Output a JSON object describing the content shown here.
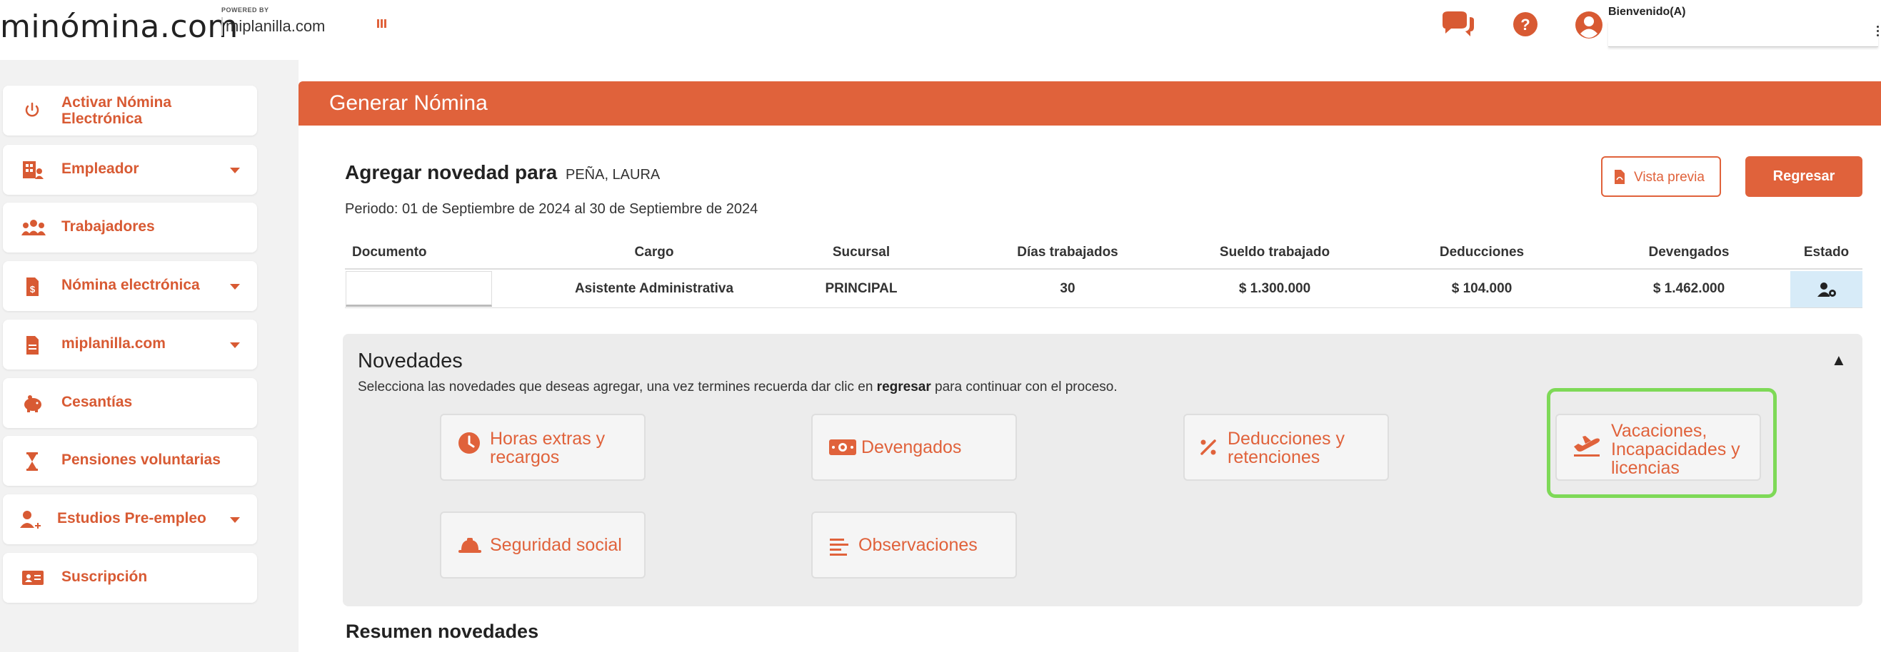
{
  "brand": {
    "logo": "minómina.com",
    "powered_by": "POWERED BY",
    "sub_brand": "miplanilla.com"
  },
  "header": {
    "welcome": "Bienvenido(A)",
    "welcome_value": ""
  },
  "sidebar": {
    "items": [
      {
        "label": "Activar Nómina\nElectrónica",
        "icon": "power-icon",
        "has_caret": false
      },
      {
        "label": "Empleador",
        "icon": "building-icon",
        "has_caret": true
      },
      {
        "label": "Trabajadores",
        "icon": "users-icon",
        "has_caret": false
      },
      {
        "label": "Nómina electrónica",
        "icon": "invoice-dollar-icon",
        "has_caret": true
      },
      {
        "label": "miplanilla.com",
        "icon": "document-icon",
        "has_caret": true
      },
      {
        "label": "Cesantías",
        "icon": "piggy-bank-icon",
        "has_caret": false
      },
      {
        "label": "Pensiones voluntarias",
        "icon": "hourglass-icon",
        "has_caret": false
      },
      {
        "label": "Estudios Pre-empleo",
        "icon": "user-plus-icon",
        "has_caret": true
      },
      {
        "label": "Suscripción",
        "icon": "id-card-icon",
        "has_caret": false
      }
    ]
  },
  "page": {
    "title": "Generar Nómina",
    "agregar_label": "Agregar novedad para",
    "employee_name": "PEÑA, LAURA",
    "periodo": "Periodo: 01 de Septiembre de 2024 al 30 de Septiembre de 2024",
    "btn_vista_previa": "Vista previa",
    "btn_regresar": "Regresar"
  },
  "table": {
    "headers": [
      "Documento",
      "Cargo",
      "Sucursal",
      "Días trabajados",
      "Sueldo trabajado",
      "Deducciones",
      "Devengados",
      "Estado"
    ],
    "row": {
      "documento": "",
      "cargo": "Asistente Administrativa",
      "sucursal": "PRINCIPAL",
      "dias": "30",
      "sueldo": "$ 1.300.000",
      "deducciones": "$ 104.000",
      "devengados": "$ 1.462.000"
    }
  },
  "novedades": {
    "title": "Novedades",
    "toggle": "▲",
    "desc_prefix": "Selecciona las novedades que deseas agregar, una vez termines recuerda dar clic en ",
    "desc_bold": "regresar",
    "desc_suffix": " para continuar con el proceso.",
    "cards": [
      {
        "label": "Horas extras y\nrecargos",
        "icon": "clock-icon"
      },
      {
        "label": "Devengados",
        "icon": "money-icon"
      },
      {
        "label": "Deducciones y\nretenciones",
        "icon": "percent-icon"
      },
      {
        "label": "Vacaciones,\nIncapacidades y\nlicencias",
        "icon": "plane-departure-icon"
      },
      {
        "label": "Seguridad social",
        "icon": "hard-hat-icon"
      },
      {
        "label": "Observaciones",
        "icon": "align-left-icon"
      }
    ]
  },
  "resumen": {
    "title": "Resumen novedades"
  },
  "colors": {
    "accent": "#e0623b",
    "highlight": "#7ed957",
    "sidebar_bg": "#f2f2f2",
    "panel_bg": "#ececec"
  }
}
